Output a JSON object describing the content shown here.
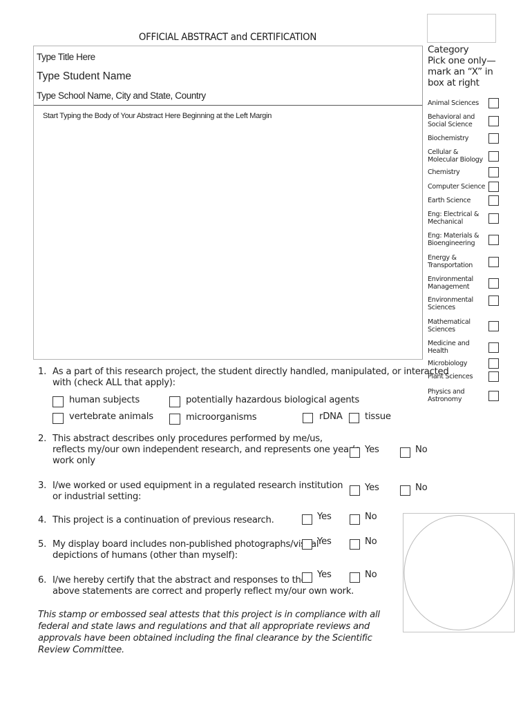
{
  "form": {
    "title": "OFFICIAL ABSTRACT and CERTIFICATION",
    "fields": {
      "project_title_placeholder": "Type Title Here",
      "student_name_placeholder": "Type Student Name",
      "school_placeholder": "Type School Name, City and State, Country",
      "abstract_body_placeholder": "Start Typing the Body of Your Abstract Here Beginning at the Left Margin"
    }
  },
  "category": {
    "heading_lines": [
      "Category",
      "Pick one only—",
      "mark an “X” in",
      "box at right"
    ],
    "items": [
      {
        "lines": [
          "Animal Sciences"
        ],
        "checked": false
      },
      {
        "lines": [
          "Behavioral and",
          "Social Science"
        ],
        "checked": false
      },
      {
        "lines": [
          "Biochemistry"
        ],
        "checked": false
      },
      {
        "lines": [
          "Cellular &",
          "Molecular Biology"
        ],
        "checked": false
      },
      {
        "lines": [
          "Chemistry"
        ],
        "checked": false
      },
      {
        "lines": [
          "Computer Science"
        ],
        "checked": false
      },
      {
        "lines": [
          "Earth  Science"
        ],
        "checked": false
      },
      {
        "lines": [
          "Eng: Electrical &",
          "Mechanical"
        ],
        "checked": false
      },
      {
        "lines": [
          "Eng: Materials &",
          "Bioengineering"
        ],
        "checked": false
      },
      {
        "lines": [
          "Energy &",
          "Transportation"
        ],
        "checked": false
      },
      {
        "lines": [
          "Environmental",
          "Management"
        ],
        "checked": false
      },
      {
        "lines": [
          "Environmental",
          "Sciences"
        ],
        "checked": false
      },
      {
        "lines": [
          "Mathematical",
          "Sciences"
        ],
        "checked": false
      },
      {
        "lines": [
          "Medicine and",
          "Health"
        ],
        "checked": false
      },
      {
        "lines": [
          "Microbiology"
        ],
        "checked": false
      },
      {
        "lines": [
          "Plant Sciences"
        ],
        "checked": false
      },
      {
        "lines": [
          "Physics and",
          "Astronomy"
        ],
        "checked": false
      }
    ]
  },
  "questions": {
    "q1": {
      "number": "1.",
      "lines": [
        "As a part of this research project, the student directly handled, manipulated, or interacted",
        "with (check ALL that apply):"
      ],
      "options": [
        {
          "label": "human subjects",
          "checked": false
        },
        {
          "label": "potentially hazardous biological agents",
          "checked": false
        },
        {
          "label": "vertebrate animals",
          "checked": false
        },
        {
          "label": "microorganisms",
          "checked": false
        },
        {
          "label": "rDNA",
          "checked": false
        },
        {
          "label": "tissue",
          "checked": false
        }
      ]
    },
    "q2": {
      "number": "2.",
      "lines": [
        "This abstract describes only procedures performed by me/us,",
        "reflects my/our own independent research, and represents one year’s",
        "work only"
      ],
      "yes": "Yes",
      "no": "No"
    },
    "q3": {
      "number": "3.",
      "lines": [
        "I/we worked or used equipment in a regulated research institution",
        "or industrial setting:"
      ],
      "yes": "Yes",
      "no": "No"
    },
    "q4": {
      "number": "4.",
      "lines": [
        "This project is a continuation of previous research."
      ],
      "yes": "Yes",
      "no": "No"
    },
    "q5": {
      "number": "5.",
      "lines": [
        "My display board includes non-published photographs/visual",
        "depictions of humans (other than myself):"
      ],
      "yes": "Yes",
      "no": "No"
    },
    "q6": {
      "number": "6.",
      "lines": [
        "I/we hereby certify that the abstract and responses to the",
        "above statements are correct and properly reflect my/our own work."
      ],
      "yes": "Yes",
      "no": "No"
    }
  },
  "statement": "This stamp or embossed seal attests that this project is in compliance with all federal and state laws and regulations and that all appropriate reviews and approvals have been obtained including the final clearance by the Scientific Review Committee.",
  "colors": {
    "border_light": "#c4c4c4",
    "border_dark": "#555555",
    "text": "#222222"
  }
}
